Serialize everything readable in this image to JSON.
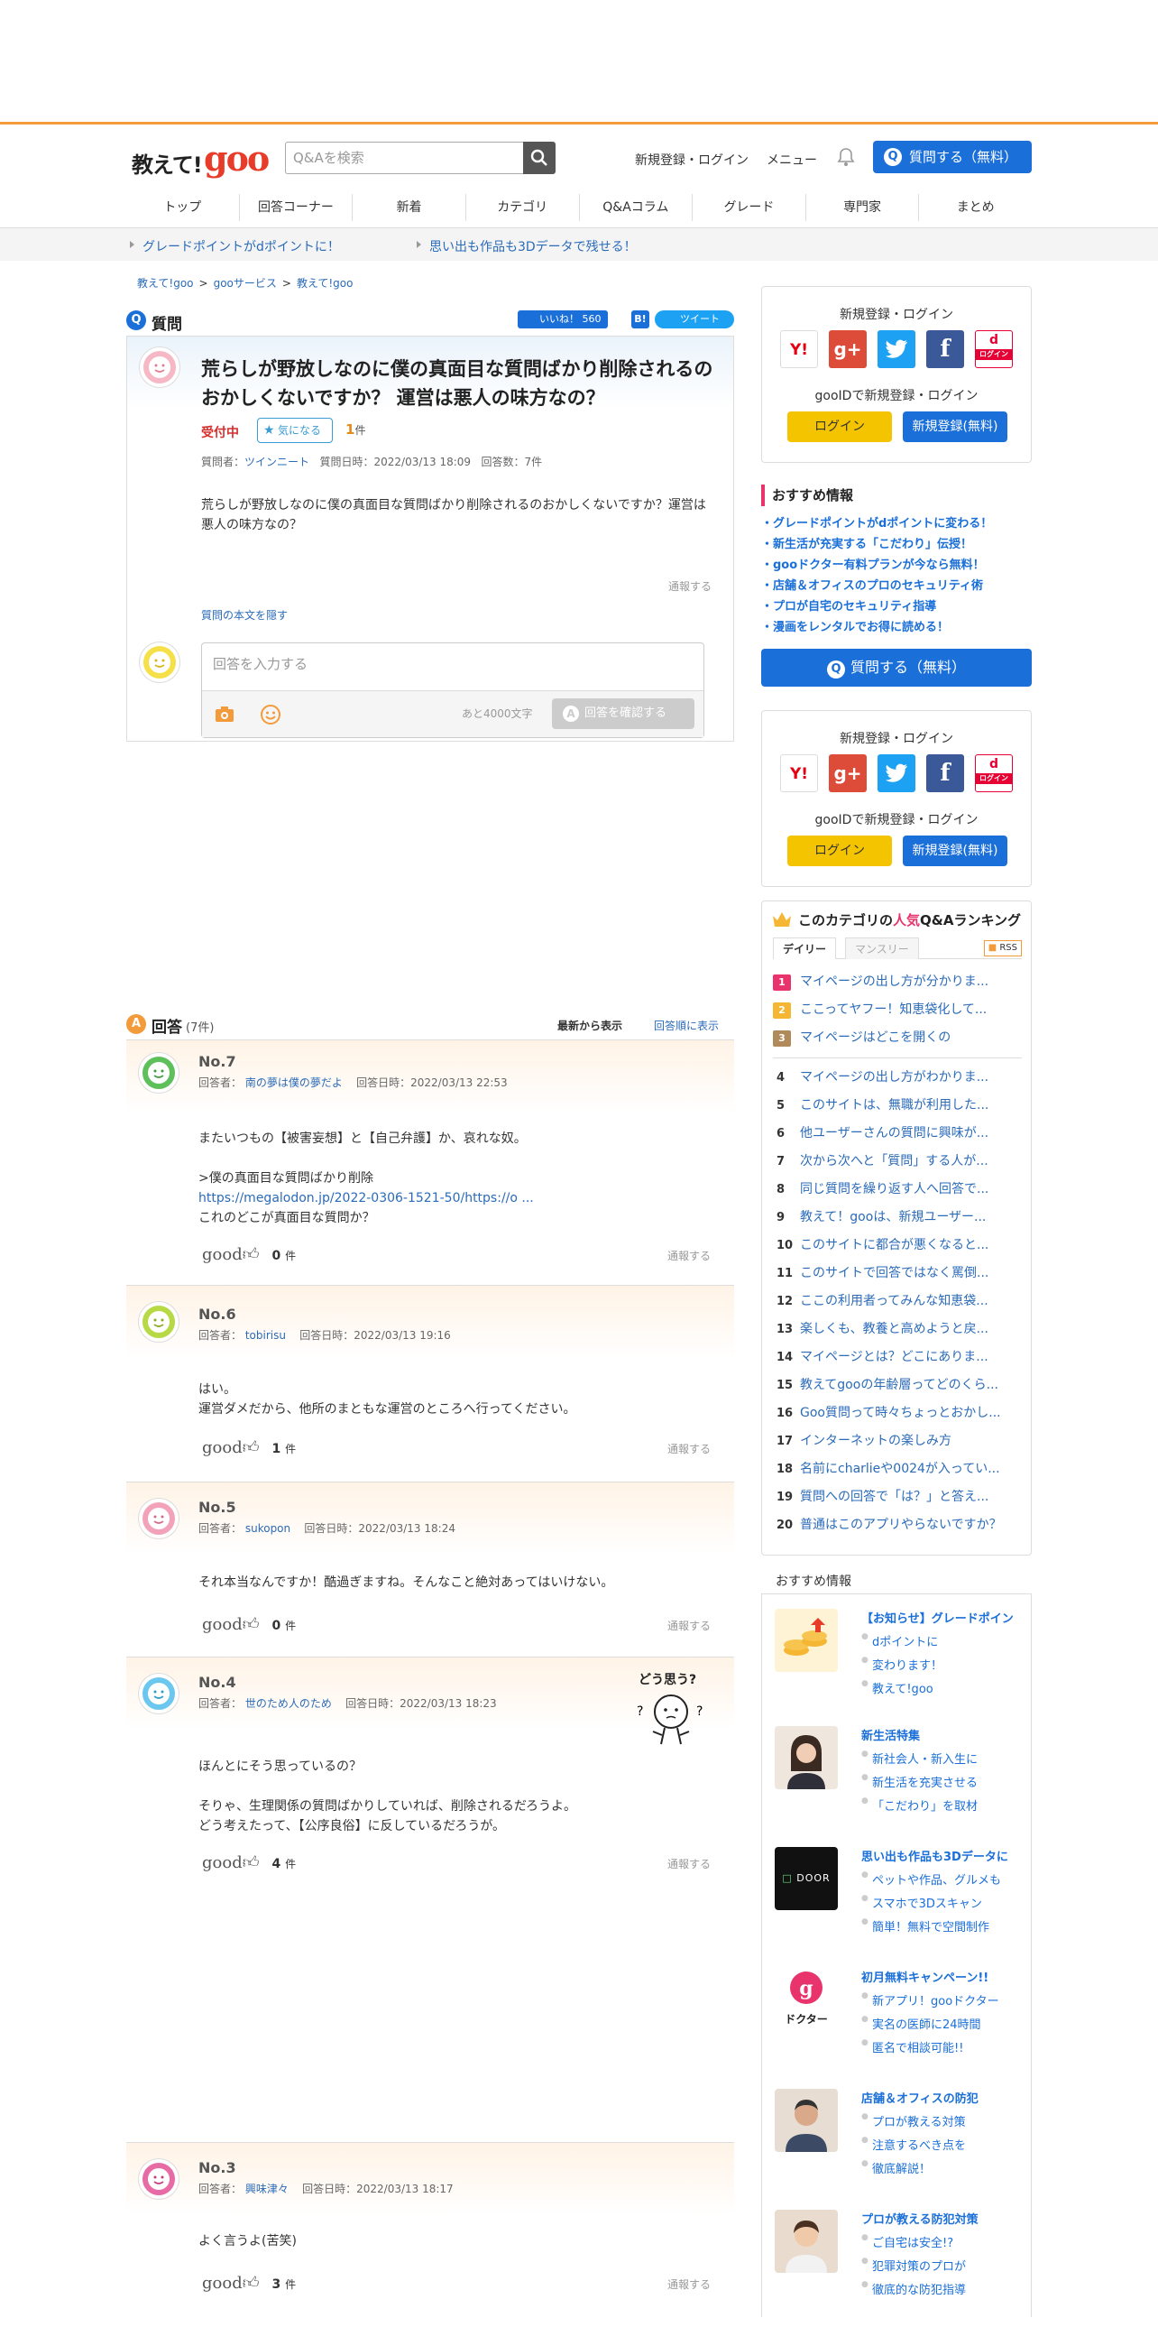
{
  "header": {
    "logo_kanji": "教えて!",
    "logo_goo": "goo",
    "search_placeholder": "Q&Aを検索",
    "register_login": "新規登録・ログイン",
    "menu": "メニュー",
    "ask_button": "質問する（無料）"
  },
  "nav": [
    "トップ",
    "回答コーナー",
    "新着",
    "カテゴリ",
    "Q&Aコラム",
    "グレード",
    "専門家",
    "まとめ"
  ],
  "infobar": [
    "グレードポイントがdポイントに！",
    "思い出も作品も3Dデータで残せる！"
  ],
  "breadcrumb": [
    "教えて!goo",
    "gooサービス",
    "教えて!goo"
  ],
  "question": {
    "section_label": "質問",
    "like_label": "いいね！ 560",
    "tweet_label": "ツイート",
    "title": "荒らしが野放しなのに僕の真面目な質問ばかり削除されるのおかしくないですか？ 運営は悪人の味方なの？",
    "status": "受付中",
    "follow_label": "気になる",
    "follow_count": "1",
    "follow_unit": "件",
    "asker_label": "質問者：",
    "asker": "ツインニート",
    "date": "質問日時：2022/03/13 18:09",
    "answer_count": "回答数：7件",
    "body": "荒らしが野放しなのに僕の真面目な質問ばかり削除されるのおかしくないですか？運営は悪人の味方なの？",
    "report": "通報する",
    "hide_body": "質問の本文を隠す",
    "answer_placeholder": "回答を入力する",
    "remaining": "あと4000文字",
    "confirm_button": "回答を確認する"
  },
  "answers_header": {
    "label": "回答",
    "count": "(7件)",
    "sort_new": "最新から表示",
    "sort_old": "回答順に表示"
  },
  "answers": [
    {
      "no": "No.7",
      "answerer_label": "回答者：",
      "answerer": "南の夢は僕の夢だよ",
      "date": "回答日時：2022/03/13 22:53",
      "lines": [
        "またいつもの【被害妄想】と【自己弁護】か、哀れな奴。",
        "",
        ">僕の真面目な質問ばかり削除"
      ],
      "link": "https://megalodon.jp/2022-0306-1521-50/https://o ...",
      "tail": "これのどこが真面目な質問か？",
      "good": "good",
      "good_count": "0",
      "unit": "件",
      "report": "通報する"
    },
    {
      "no": "No.6",
      "answerer_label": "回答者：",
      "answerer": "tobirisu",
      "date": "回答日時：2022/03/13 19:16",
      "lines": [
        "はい。",
        "運営ダメだから、他所のまともな運営のところへ行ってください。"
      ],
      "good": "good",
      "good_count": "1",
      "unit": "件",
      "report": "通報する"
    },
    {
      "no": "No.5",
      "answerer_label": "回答者：",
      "answerer": "sukopon",
      "date": "回答日時：2022/03/13 18:24",
      "lines": [
        "それ本当なんですか！酷過ぎますね。そんなこと絶対あってはいけない。"
      ],
      "good": "good",
      "good_count": "0",
      "unit": "件",
      "report": "通報する"
    },
    {
      "no": "No.4",
      "answerer_label": "回答者：",
      "answerer": "世のため人のため",
      "date": "回答日時：2022/03/13 18:23",
      "lines": [
        "ほんとにそう思っているの？",
        "",
        "そりゃ、生理関係の質問ばかりしていれば、削除されるだろうよ。",
        "どう考えたって、【公序良俗】に反しているだろうが。"
      ],
      "stamp": "どう思う?",
      "good": "good",
      "good_count": "4",
      "unit": "件",
      "report": "通報する"
    },
    {
      "no": "No.3",
      "answerer_label": "回答者：",
      "answerer": "興味津々",
      "date": "回答日時：2022/03/13 18:17",
      "lines": [
        "よく言うよ(苦笑)"
      ],
      "good": "good",
      "good_count": "3",
      "unit": "件",
      "report": "通報する"
    }
  ],
  "login_box": {
    "title": "新規登録・ログイン",
    "gooid": "gooIDで新規登録・ログイン",
    "login": "ログイン",
    "register": "新規登録(無料)",
    "docomo": "ログイン"
  },
  "recommend": {
    "title": "おすすめ情報",
    "items": [
      "・グレードポイントがdポイントに変わる！",
      "・新生活が充実する「こだわり」伝授！",
      "・gooドクター有料プランが今なら無料！",
      "・店舗＆オフィスのプロのセキュリティ術",
      "・プロが自宅のセキュリティ指導",
      "・漫画をレンタルでお得に読める！"
    ]
  },
  "ask_big": "質問する（無料）",
  "ranking": {
    "title_pre": "このカテゴリの",
    "title_hot": "人気",
    "title_post": "Q&Aランキング",
    "tab_daily": "デイリー",
    "tab_monthly": "マンスリー",
    "rss": "RSS",
    "top3": [
      "マイページの出し方が分かりま...",
      "ここってヤフー！知恵袋化して...",
      "マイページはどこを開くの"
    ],
    "items": [
      {
        "n": "4",
        "t": "マイページの出し方がわかりま..."
      },
      {
        "n": "5",
        "t": "このサイトは、無職が利用した..."
      },
      {
        "n": "6",
        "t": "他ユーザーさんの質問に興味が..."
      },
      {
        "n": "7",
        "t": "次から次へと「質問」する人が..."
      },
      {
        "n": "8",
        "t": "同じ質問を繰り返す人へ回答で..."
      },
      {
        "n": "9",
        "t": "教えて！gooは、新規ユーザー..."
      },
      {
        "n": "10",
        "t": "このサイトに都合が悪くなると..."
      },
      {
        "n": "11",
        "t": "このサイトで回答ではなく罵倒..."
      },
      {
        "n": "12",
        "t": "ここの利用者ってみんな知恵袋..."
      },
      {
        "n": "13",
        "t": "楽しくも、教養と高めようと戻..."
      },
      {
        "n": "14",
        "t": "マイページとは？どこにありま..."
      },
      {
        "n": "15",
        "t": "教えてgooの年齢層ってどのくら..."
      },
      {
        "n": "16",
        "t": "Goo質問って時々ちょっとおかし..."
      },
      {
        "n": "17",
        "t": "インターネットの楽しみ方"
      },
      {
        "n": "18",
        "t": "名前にcharlieや0024が入ってい..."
      },
      {
        "n": "19",
        "t": "質問への回答で「は？」と答え..."
      },
      {
        "n": "20",
        "t": "普通はこのアプリやらないですか？"
      }
    ]
  },
  "osusume": {
    "title": "おすすめ情報",
    "cards": [
      {
        "title": "【お知らせ】グレードポイン",
        "lines": [
          "dポイントに",
          "変わります！",
          "教えて!goo"
        ],
        "color": "#f5b733"
      },
      {
        "title": "新生活特集",
        "lines": [
          "新社会人・新入生に",
          "新生活を充実させる",
          "「こだわり」を取材"
        ],
        "color": "#d9c8bb"
      },
      {
        "title": "思い出も作品も3Dデータに",
        "lines": [
          "ペットや作品、グルメも",
          "スマホで3Dスキャン",
          "簡単！無料で空間制作"
        ],
        "color": "#111111",
        "label": "DOOR"
      },
      {
        "title": "初月無料キャンペーン!!",
        "lines": [
          "新アプリ！gooドクター",
          "実名の医師に24時間",
          "匿名で相談可能!!"
        ],
        "color": "#ffffff",
        "label": "ドクター"
      },
      {
        "title": "店舗＆オフィスの防犯",
        "lines": [
          "プロが教える対策",
          "注意するべき点を",
          "徹底解説！"
        ],
        "color": "#c9a98a"
      },
      {
        "title": "プロが教える防犯対策",
        "lines": [
          "ご自宅は安全!?",
          "犯罪対策のプロが",
          "徹底的な防犯指導"
        ],
        "color": "#d4b396"
      }
    ]
  },
  "colors": {
    "accent": "#f39b3b",
    "primary": "#1a6fd8",
    "link": "#2b6bb8",
    "status": "#d42e2e"
  }
}
